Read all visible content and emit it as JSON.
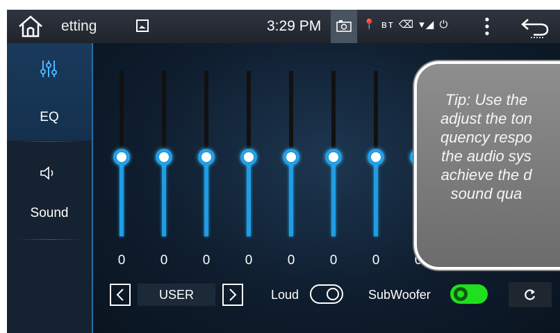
{
  "statusbar": {
    "title": "etting",
    "time": "3:29 PM",
    "icons": [
      "home-icon",
      "gallery-icon",
      "screenshot-icon",
      "location-icon",
      "bluetooth-icon",
      "usb-icon",
      "wifi-icon",
      "signal-icon",
      "power-icon",
      "menu-icon",
      "back-icon"
    ],
    "status_glyphs": "📍 ʙᴛ ⌫ ▾◢ ⏻"
  },
  "sidebar": {
    "items": [
      {
        "label": "EQ",
        "icon": "equalizer-icon",
        "active": true
      },
      {
        "label": "Sound",
        "icon": "speaker-icon",
        "active": false
      }
    ]
  },
  "equalizer": {
    "bands": [
      {
        "value": "0"
      },
      {
        "value": "0"
      },
      {
        "value": "0"
      },
      {
        "value": "0"
      },
      {
        "value": "0"
      },
      {
        "value": "0"
      },
      {
        "value": "0"
      },
      {
        "value": "0"
      }
    ],
    "accent_color": "#1f9de3"
  },
  "tip": {
    "lines": [
      "Tip: Use the",
      "adjust the ton",
      "quency respo",
      "the audio sys",
      "achieve the d",
      "sound qua"
    ]
  },
  "bottombar": {
    "preset": "USER",
    "loud_label": "Loud",
    "loud_on": false,
    "subwoofer_label": "SubWoofer",
    "subwoofer_on": true,
    "subwoofer_color": "#1fe01f"
  }
}
